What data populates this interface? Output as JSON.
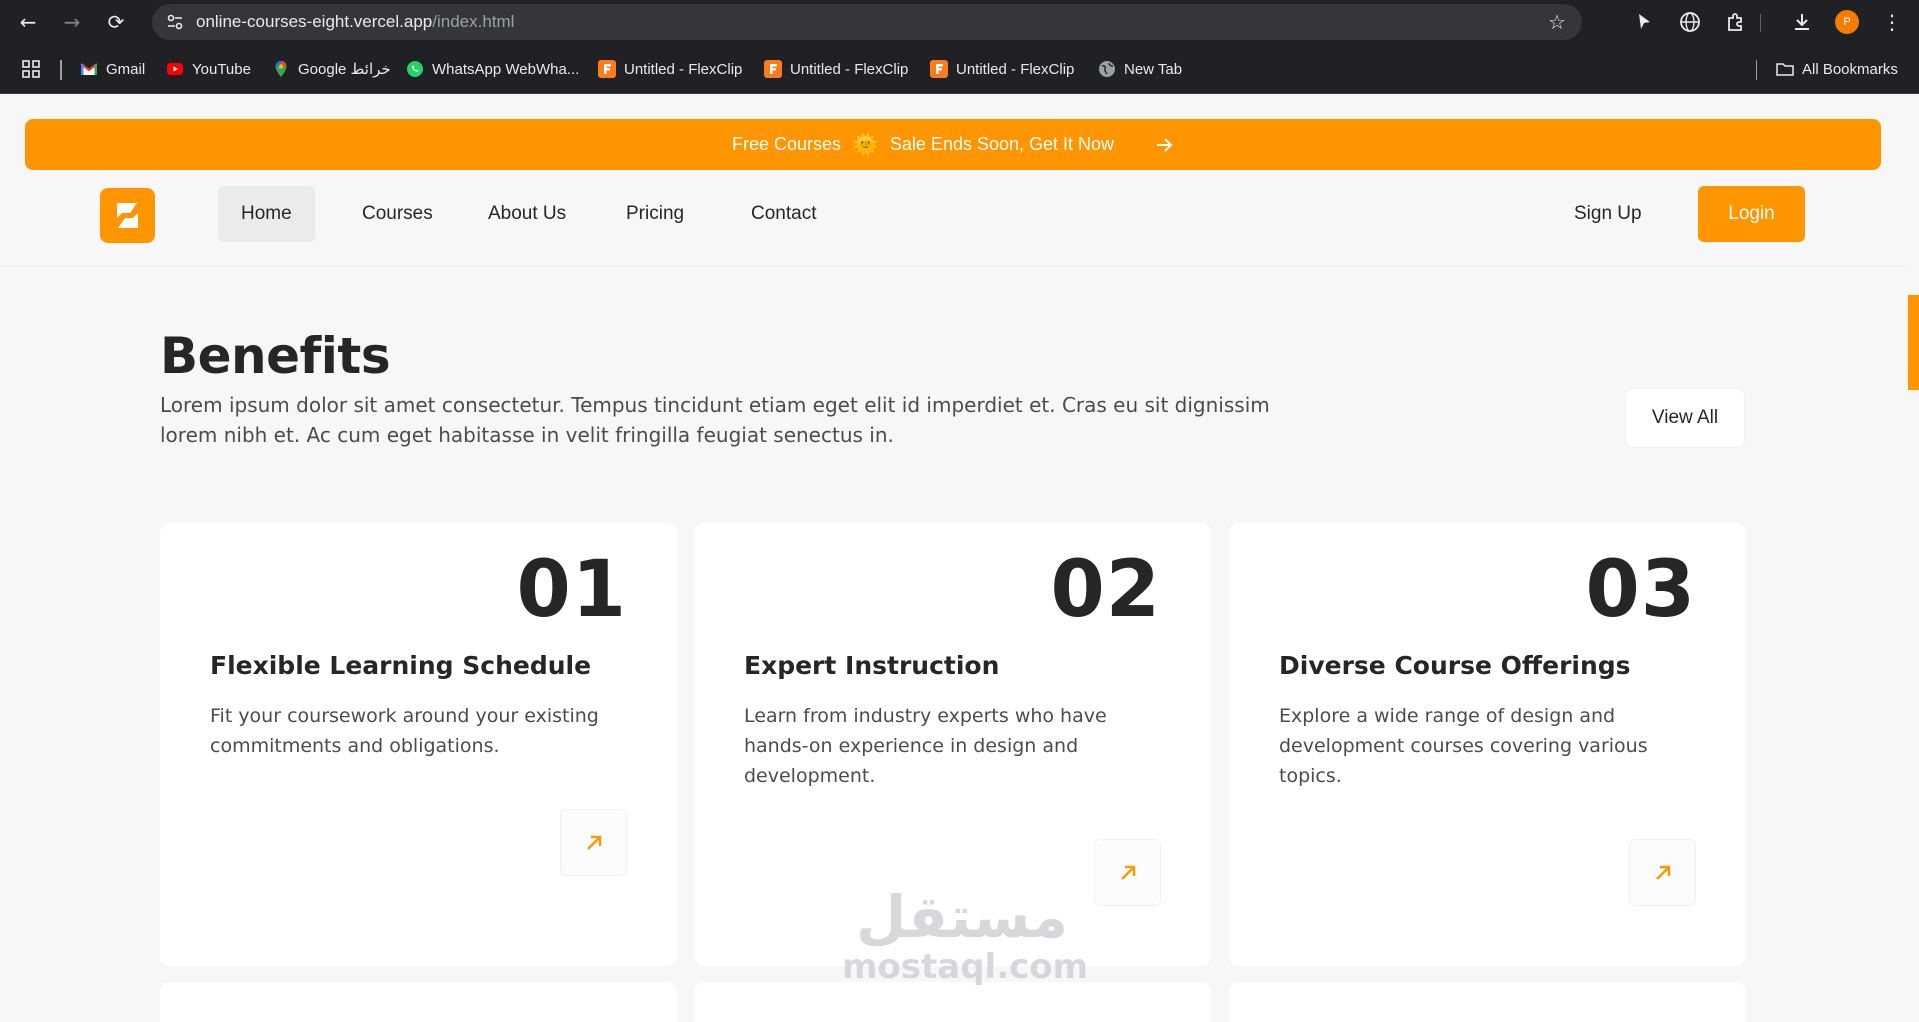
{
  "browser": {
    "url_host": "online-courses-eight.vercel.app",
    "url_path": "/index.html",
    "profile_initial": "P",
    "bookmarks": [
      {
        "label": "Gmail",
        "icon": "gmail-icon"
      },
      {
        "label": "YouTube",
        "icon": "youtube-icon"
      },
      {
        "label": "Google خرائط",
        "icon": "maps-icon"
      },
      {
        "label": "WhatsApp WebWha...",
        "icon": "whatsapp-icon"
      },
      {
        "label": "Untitled - FlexClip",
        "icon": "flexclip-icon"
      },
      {
        "label": "Untitled - FlexClip",
        "icon": "flexclip-icon"
      },
      {
        "label": "Untitled - FlexClip",
        "icon": "flexclip-icon"
      },
      {
        "label": "New Tab",
        "icon": "globe-icon"
      }
    ],
    "all_bookmarks": "All Bookmarks"
  },
  "promo": {
    "text_left": "Free Courses",
    "sun": "🌞",
    "text_right": "Sale Ends Soon, Get It Now"
  },
  "nav": {
    "items": [
      "Home",
      "Courses",
      "About Us",
      "Pricing",
      "Contact"
    ],
    "active": "Home",
    "signup": "Sign Up",
    "login": "Login"
  },
  "benefits": {
    "title": "Benefits",
    "description": "Lorem ipsum dolor sit amet consectetur. Tempus tincidunt etiam eget elit id imperdiet et. Cras eu sit dignissim lorem nibh et. Ac cum eget habitasse in velit fringilla feugiat senectus in.",
    "view_all": "View All",
    "cards": [
      {
        "number": "01",
        "title": "Flexible Learning Schedule",
        "text": "Fit your coursework around your existing commitments and obligations."
      },
      {
        "number": "02",
        "title": "Expert Instruction",
        "text": "Learn from industry experts who have hands-on experience in design and development."
      },
      {
        "number": "03",
        "title": "Diverse Course Offerings",
        "text": "Explore a wide range of design and development courses covering various topics."
      }
    ]
  },
  "watermark": {
    "arabic": "مستقل",
    "latin": "mostaql.com"
  },
  "colors": {
    "accent": "#ff9500",
    "text": "#262626",
    "muted": "#4c4c4d",
    "page_bg": "#f7f7f8"
  }
}
